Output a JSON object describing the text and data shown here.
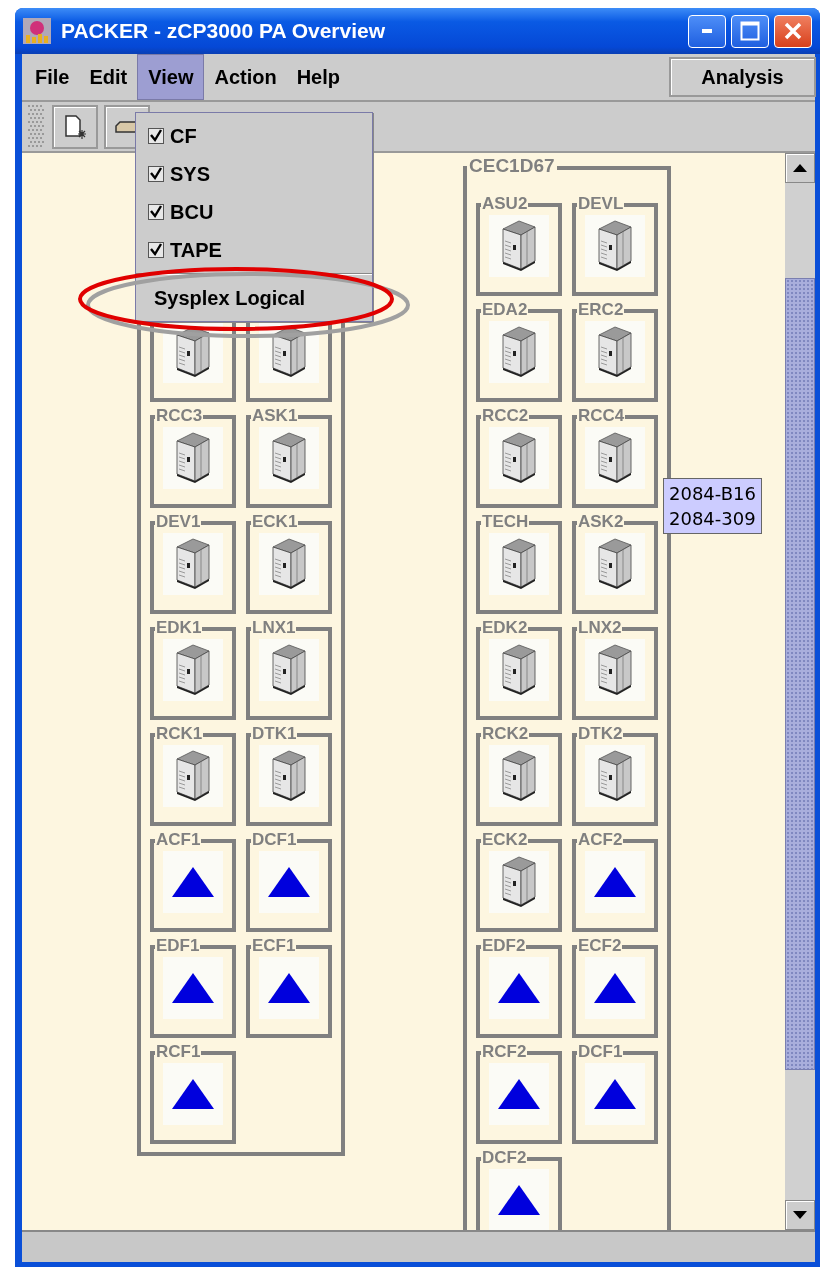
{
  "window": {
    "title": "PACKER - zCP3000 PA Overview"
  },
  "menu_bar": [
    {
      "label": "File",
      "selected": false
    },
    {
      "label": "Edit",
      "selected": false
    },
    {
      "label": "View",
      "selected": true
    },
    {
      "label": "Action",
      "selected": false
    },
    {
      "label": "Help",
      "selected": false
    }
  ],
  "analysis_button": {
    "label": "Analysis"
  },
  "view_menu": [
    {
      "kind": "check",
      "label": "CF",
      "checked": true
    },
    {
      "kind": "check",
      "label": "SYS",
      "checked": true
    },
    {
      "kind": "check",
      "label": "BCU",
      "checked": true
    },
    {
      "kind": "check",
      "label": "TAPE",
      "checked": true
    },
    {
      "kind": "separator"
    },
    {
      "kind": "command",
      "label": "Sysplex Logical"
    }
  ],
  "groups": [
    {
      "items": [
        {
          "kind": "server"
        },
        {
          "kind": "server"
        },
        {
          "label": "RCC3",
          "kind": "server"
        },
        {
          "label": "ASK1",
          "kind": "server"
        },
        {
          "label": "DEV1",
          "kind": "server"
        },
        {
          "label": "ECK1",
          "kind": "server"
        },
        {
          "label": "EDK1",
          "kind": "server"
        },
        {
          "label": "LNX1",
          "kind": "server"
        },
        {
          "label": "RCK1",
          "kind": "server"
        },
        {
          "label": "DTK1",
          "kind": "server"
        },
        {
          "label": "ACF1",
          "kind": "cf"
        },
        {
          "label": "DCF1",
          "kind": "cf"
        },
        {
          "label": "EDF1",
          "kind": "cf"
        },
        {
          "label": "ECF1",
          "kind": "cf"
        },
        {
          "label": "RCF1",
          "kind": "cf"
        }
      ]
    },
    {
      "label": "CEC1D67",
      "items": [
        {
          "label": "ASU2",
          "kind": "server"
        },
        {
          "label": "DEVL",
          "kind": "server"
        },
        {
          "label": "EDA2",
          "kind": "server"
        },
        {
          "label": "ERC2",
          "kind": "server"
        },
        {
          "label": "RCC2",
          "kind": "server"
        },
        {
          "label": "RCC4",
          "kind": "server"
        },
        {
          "label": "TECH",
          "kind": "server"
        },
        {
          "label": "ASK2",
          "kind": "server"
        },
        {
          "label": "EDK2",
          "kind": "server"
        },
        {
          "label": "LNX2",
          "kind": "server"
        },
        {
          "label": "RCK2",
          "kind": "server"
        },
        {
          "label": "DTK2",
          "kind": "server"
        },
        {
          "label": "ECK2",
          "kind": "server"
        },
        {
          "label": "ACF2",
          "kind": "cf"
        },
        {
          "label": "EDF2",
          "kind": "cf"
        },
        {
          "label": "ECF2",
          "kind": "cf"
        },
        {
          "label": "RCF2",
          "kind": "cf"
        },
        {
          "label": "DCF1",
          "kind": "cf"
        },
        {
          "label": "DCF2",
          "kind": "cf"
        }
      ]
    }
  ],
  "tooltip": {
    "lines": [
      "2084-B16",
      "2084-309"
    ]
  }
}
